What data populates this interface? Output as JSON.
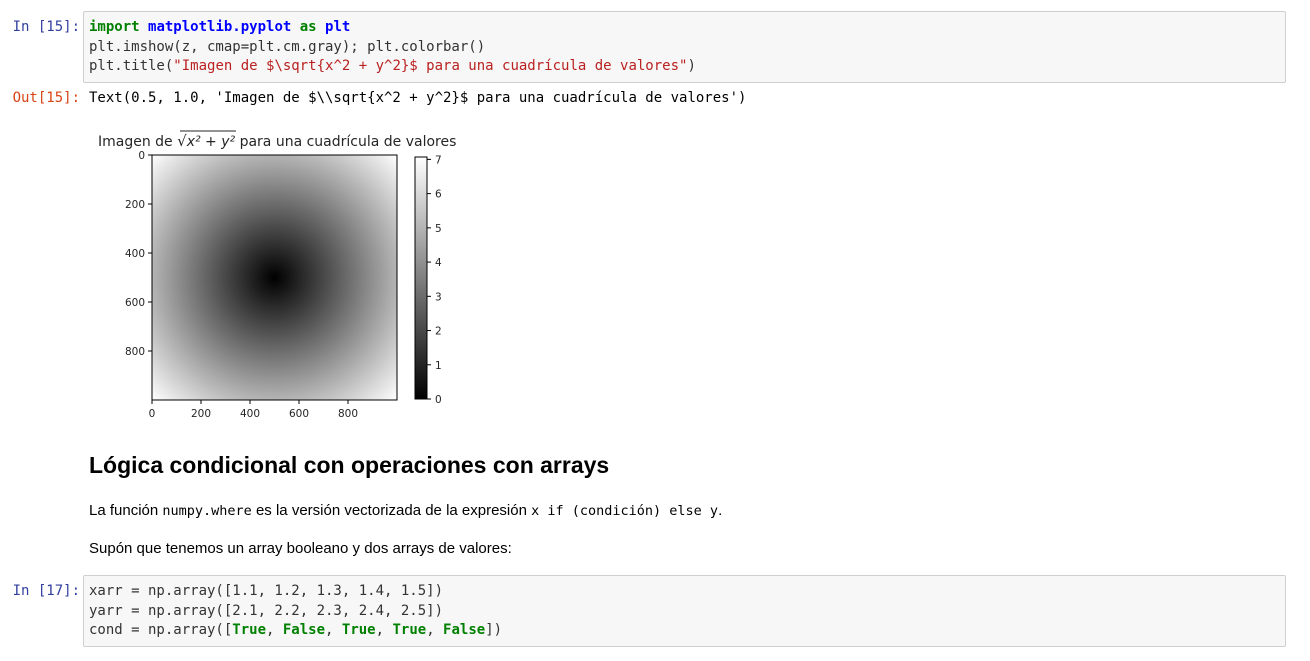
{
  "cell1": {
    "prompt": "In [15]:",
    "code": {
      "line1": {
        "kw1": "import",
        "module": "matplotlib.pyplot",
        "kw2": "as",
        "alias": "plt"
      },
      "line2": "plt.imshow(z, cmap=plt.cm.gray); plt.colorbar()",
      "line3": {
        "prefix": "plt.title(",
        "string": "\"Imagen de $\\sqrt{x^2 + y^2}$ para una cuadrícula de valores\"",
        "suffix": ")"
      }
    }
  },
  "output1": {
    "prompt": "Out[15]:",
    "text": "Text(0.5, 1.0, 'Imagen de $\\\\sqrt{x^2 + y^2}$ para una cuadrícula de valores')"
  },
  "chart_data": {
    "type": "heatmap",
    "title": {
      "before": "Imagen de ",
      "sqrt_expr": "x² + y²",
      "after": " para una cuadrícula de valores"
    },
    "colormap": "gray",
    "x_ticks": [
      "0",
      "200",
      "400",
      "600",
      "800"
    ],
    "y_ticks": [
      "0",
      "200",
      "400",
      "600",
      "800"
    ],
    "xlim": [
      0,
      1000
    ],
    "ylim": [
      1000,
      0
    ],
    "center": [
      500,
      500
    ],
    "value_range": [
      0,
      7.07
    ],
    "colorbar_ticks": [
      "0",
      "1",
      "2",
      "3",
      "4",
      "5",
      "6",
      "7"
    ],
    "colorbar_range": [
      0,
      7.07
    ]
  },
  "markdown": {
    "heading": "Lógica condicional con operaciones con arrays",
    "p1": {
      "t1": "La función ",
      "c1": "numpy.where",
      "t2": " es la versión vectorizada de la expresión ",
      "c2": "x if (condición) else y",
      "t3": "."
    },
    "p2": "Supón que tenemos un array booleano y dos arrays de valores:"
  },
  "cell2": {
    "prompt": "In [17]:",
    "line1": "xarr = np.array([1.1, 1.2, 1.3, 1.4, 1.5])",
    "line2": "yarr = np.array([2.1, 2.2, 2.3, 2.4, 2.5])",
    "line3": {
      "prefix": "cond = np.array([",
      "v1": "True",
      "s1": ", ",
      "v2": "False",
      "s2": ", ",
      "v3": "True",
      "s3": ", ",
      "v4": "True",
      "s4": ", ",
      "v5": "False",
      "suffix": "])"
    }
  }
}
